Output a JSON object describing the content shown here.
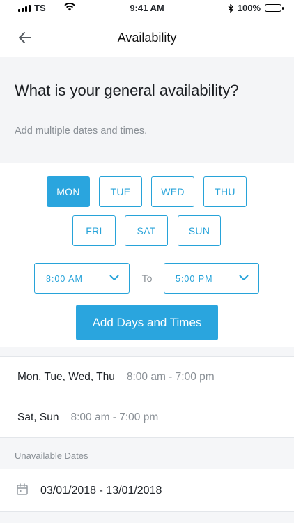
{
  "status_bar": {
    "carrier": "TS",
    "time": "9:41 AM",
    "battery": "100%"
  },
  "nav": {
    "title": "Availability",
    "back_icon": "arrow-left-icon"
  },
  "header": {
    "heading": "What is your general availability?",
    "subheading": "Add multiple dates and times."
  },
  "days": [
    {
      "label": "MON",
      "selected": true
    },
    {
      "label": "TUE",
      "selected": false
    },
    {
      "label": "WED",
      "selected": false
    },
    {
      "label": "THU",
      "selected": false
    },
    {
      "label": "FRI",
      "selected": false
    },
    {
      "label": "SAT",
      "selected": false
    },
    {
      "label": "SUN",
      "selected": false
    }
  ],
  "time_range": {
    "start": "8:00 AM",
    "separator": "To",
    "end": "5:00 PM"
  },
  "add_button": "Add Days and Times",
  "availability": [
    {
      "days": "Mon, Tue, Wed, Thu",
      "times": "8:00 am - 7:00 pm"
    },
    {
      "days": "Sat, Sun",
      "times": "8:00 am - 7:00 pm"
    }
  ],
  "unavailable": {
    "label": "Unavailable Dates",
    "range": "03/01/2018 - 13/01/2018",
    "icon": "calendar-icon"
  },
  "colors": {
    "accent": "#2aa5de",
    "muted_text": "#8a9096",
    "panel_bg": "#f4f5f7"
  }
}
